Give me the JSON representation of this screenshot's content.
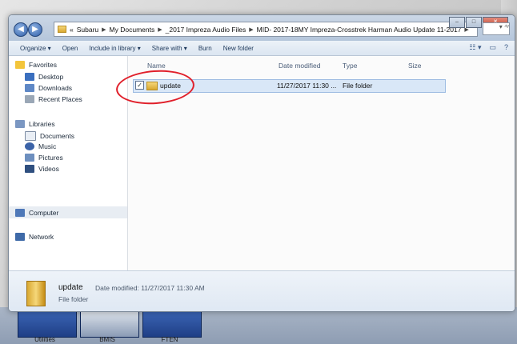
{
  "window": {
    "address_segments": [
      "«",
      "Subaru",
      "My Documents",
      "_2017 Impreza Audio Files",
      "MID- 2017-18MY Impreza-Crosstrek Harman Audio Update 11-2017"
    ]
  },
  "toolbar": {
    "organize": "Organize ▾",
    "open": "Open",
    "include_in_library": "Include in library ▾",
    "share_with": "Share with ▾",
    "burn": "Burn",
    "new_folder": "New folder"
  },
  "navigation": {
    "favorites": "Favorites",
    "desktop": "Desktop",
    "downloads": "Downloads",
    "recent_places": "Recent Places",
    "libraries": "Libraries",
    "documents": "Documents",
    "music": "Music",
    "pictures": "Pictures",
    "videos": "Videos",
    "computer": "Computer",
    "network": "Network"
  },
  "columns": {
    "name": "Name",
    "date_modified": "Date modified",
    "type": "Type",
    "size": "Size"
  },
  "files": [
    {
      "name": "update",
      "date_modified": "11/27/2017 11:30 ...",
      "type": "File folder",
      "size": ""
    }
  ],
  "details": {
    "name": "update",
    "date_modified_label": "Date modified:",
    "date_modified_value": "11/27/2017 11:30 AM",
    "type": "File folder"
  },
  "taskbar": {
    "items": [
      "Utilities",
      "BMIS",
      "FTEN"
    ]
  },
  "colors": {
    "selection": "#d9e7f7",
    "annotation_circle": "#e01f2a",
    "taskbar_button": "#1f3f86"
  }
}
